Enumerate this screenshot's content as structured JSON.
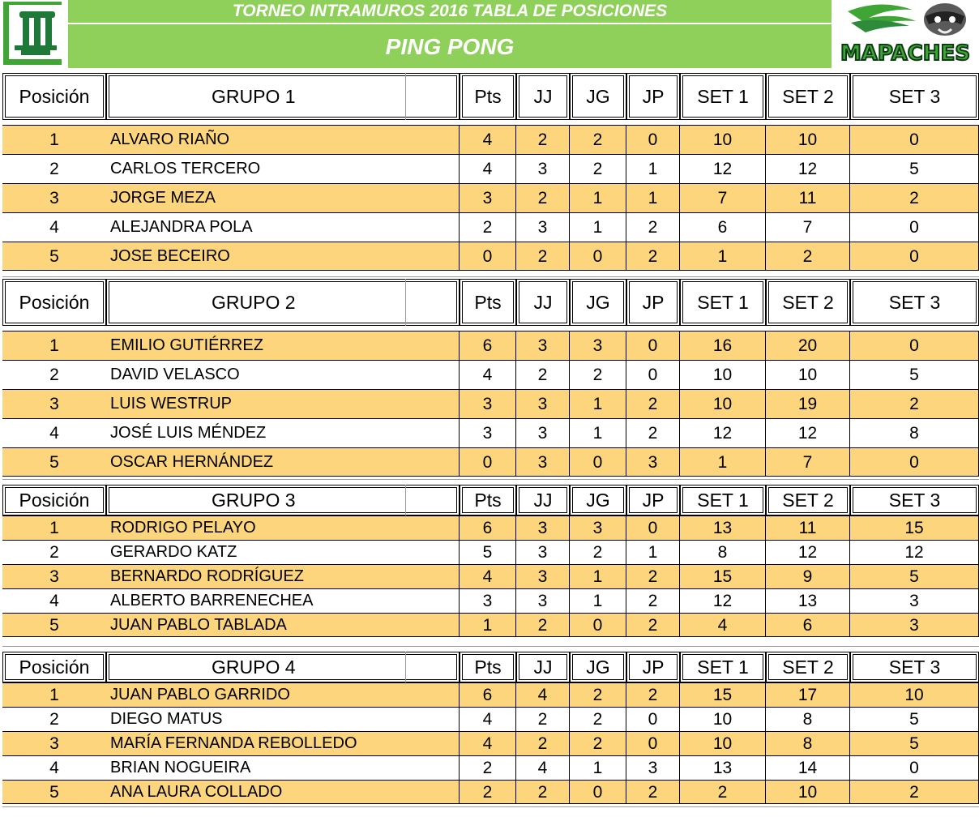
{
  "header": {
    "title": "TORNEO INTRAMUROS 2016 TABLA DE POSICIONES",
    "subtitle": "PING PONG",
    "logo_right_text": "MAPACHES"
  },
  "colors": {
    "banner": "#8fd05a",
    "row_highlight": "#fdd57c",
    "row_plain": "#ffffff",
    "logo_green": "#3fa535",
    "logo_dark_green": "#1f7a3a"
  },
  "columns": [
    "Posición",
    "",
    "Pts",
    "JJ",
    "JG",
    "JP",
    "SET 1",
    "SET 2",
    "SET 3"
  ],
  "groups": [
    {
      "title": "GRUPO 1",
      "rows": [
        {
          "pos": "1",
          "name": "ALVARO RIAÑO",
          "pts": "4",
          "jj": "2",
          "jg": "2",
          "jp": "0",
          "s1": "10",
          "s2": "10",
          "s3": "0"
        },
        {
          "pos": "2",
          "name": "CARLOS TERCERO",
          "pts": "4",
          "jj": "3",
          "jg": "2",
          "jp": "1",
          "s1": "12",
          "s2": "12",
          "s3": "5"
        },
        {
          "pos": "3",
          "name": "JORGE MEZA",
          "pts": "3",
          "jj": "2",
          "jg": "1",
          "jp": "1",
          "s1": "7",
          "s2": "11",
          "s3": "2"
        },
        {
          "pos": "4",
          "name": "ALEJANDRA POLA",
          "pts": "2",
          "jj": "3",
          "jg": "1",
          "jp": "2",
          "s1": "6",
          "s2": "7",
          "s3": "0"
        },
        {
          "pos": "5",
          "name": "JOSE BECEIRO",
          "pts": "0",
          "jj": "2",
          "jg": "0",
          "jp": "2",
          "s1": "1",
          "s2": "2",
          "s3": "0"
        }
      ]
    },
    {
      "title": "GRUPO 2",
      "rows": [
        {
          "pos": "1",
          "name": "EMILIO GUTIÉRREZ",
          "pts": "6",
          "jj": "3",
          "jg": "3",
          "jp": "0",
          "s1": "16",
          "s2": "20",
          "s3": "0"
        },
        {
          "pos": "2",
          "name": "DAVID VELASCO",
          "pts": "4",
          "jj": "2",
          "jg": "2",
          "jp": "0",
          "s1": "10",
          "s2": "10",
          "s3": "5"
        },
        {
          "pos": "3",
          "name": "LUIS WESTRUP",
          "pts": "3",
          "jj": "3",
          "jg": "1",
          "jp": "2",
          "s1": "10",
          "s2": "19",
          "s3": "2"
        },
        {
          "pos": "4",
          "name": "JOSÉ LUIS MÉNDEZ",
          "pts": "3",
          "jj": "3",
          "jg": "1",
          "jp": "2",
          "s1": "12",
          "s2": "12",
          "s3": "8"
        },
        {
          "pos": "5",
          "name": "OSCAR HERNÁNDEZ",
          "pts": "0",
          "jj": "3",
          "jg": "0",
          "jp": "3",
          "s1": "1",
          "s2": "7",
          "s3": "0"
        }
      ]
    },
    {
      "title": "GRUPO 3",
      "rows": [
        {
          "pos": "1",
          "name": "RODRIGO PELAYO",
          "pts": "6",
          "jj": "3",
          "jg": "3",
          "jp": "0",
          "s1": "13",
          "s2": "11",
          "s3": "15"
        },
        {
          "pos": "2",
          "name": "GERARDO KATZ",
          "pts": "5",
          "jj": "3",
          "jg": "2",
          "jp": "1",
          "s1": "8",
          "s2": "12",
          "s3": "12"
        },
        {
          "pos": "3",
          "name": "BERNARDO RODRÍGUEZ",
          "pts": "4",
          "jj": "3",
          "jg": "1",
          "jp": "2",
          "s1": "15",
          "s2": "9",
          "s3": "5"
        },
        {
          "pos": "4",
          "name": "ALBERTO BARRENECHEA",
          "pts": "3",
          "jj": "3",
          "jg": "1",
          "jp": "2",
          "s1": "12",
          "s2": "13",
          "s3": "3"
        },
        {
          "pos": "5",
          "name": "JUAN PABLO TABLADA",
          "pts": "1",
          "jj": "2",
          "jg": "0",
          "jp": "2",
          "s1": "4",
          "s2": "6",
          "s3": "3"
        }
      ]
    },
    {
      "title": "GRUPO 4",
      "rows": [
        {
          "pos": "1",
          "name": "JUAN PABLO GARRIDO",
          "pts": "6",
          "jj": "4",
          "jg": "2",
          "jp": "2",
          "s1": "15",
          "s2": "17",
          "s3": "10"
        },
        {
          "pos": "2",
          "name": "DIEGO MATUS",
          "pts": "4",
          "jj": "2",
          "jg": "2",
          "jp": "0",
          "s1": "10",
          "s2": "8",
          "s3": "5"
        },
        {
          "pos": "3",
          "name": "MARÍA FERNANDA REBOLLEDO",
          "pts": "4",
          "jj": "2",
          "jg": "2",
          "jp": "0",
          "s1": "10",
          "s2": "8",
          "s3": "5"
        },
        {
          "pos": "4",
          "name": "BRIAN NOGUEIRA",
          "pts": "2",
          "jj": "4",
          "jg": "1",
          "jp": "3",
          "s1": "13",
          "s2": "14",
          "s3": "0"
        },
        {
          "pos": "5",
          "name": "ANA LAURA COLLADO",
          "pts": "2",
          "jj": "2",
          "jg": "0",
          "jp": "2",
          "s1": "2",
          "s2": "10",
          "s3": "2"
        }
      ]
    }
  ]
}
